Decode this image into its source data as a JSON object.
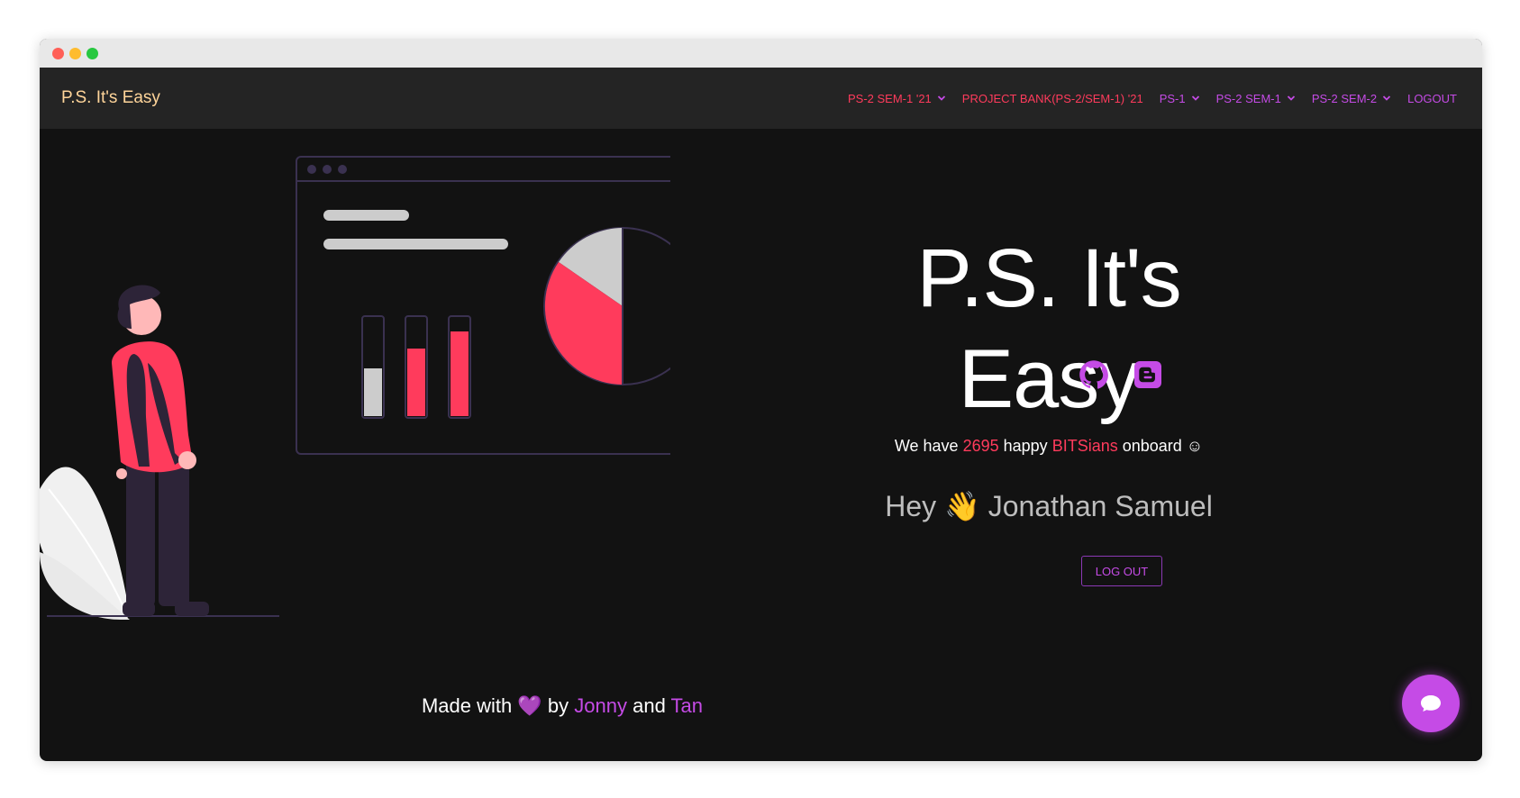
{
  "navbar": {
    "brand": "P.S. It's Easy",
    "items": [
      {
        "label": "PS-2 SEM-1 '21",
        "dropdown": true,
        "color": "#ff3b5c"
      },
      {
        "label": "PROJECT BANK(PS-2/SEM-1) '21",
        "dropdown": false,
        "color": "#ff3b5c"
      },
      {
        "label": "PS-1",
        "dropdown": true,
        "color": "#c54be6"
      },
      {
        "label": "PS-2 SEM-1",
        "dropdown": true,
        "color": "#c54be6"
      },
      {
        "label": "PS-2 SEM-2",
        "dropdown": true,
        "color": "#c54be6"
      },
      {
        "label": "LOGOUT",
        "dropdown": false,
        "color": "#c54be6"
      }
    ]
  },
  "hero": {
    "title": "P.S. It's Easy",
    "socials": [
      {
        "icon": "github-icon"
      },
      {
        "icon": "blogger-icon"
      }
    ],
    "stats": {
      "prefix": "We have",
      "count": "2695",
      "middle": "happy",
      "highlight": "BITSians",
      "suffix": "onboard ☺"
    },
    "greeting": {
      "hey": "Hey",
      "emoji": "👋",
      "name": "Jonathan Samuel"
    },
    "logout_button": "LOG OUT"
  },
  "footer": {
    "made_with": "Made with",
    "heart": "💜",
    "by": "by",
    "author1": "Jonny",
    "and": "and",
    "author2": "Tan"
  },
  "colors": {
    "accent_red": "#ff3b5c",
    "accent_purple": "#c54be6",
    "background": "#121212",
    "navbar": "#242424",
    "brand": "#ffd59a"
  },
  "chat": {
    "icon": "chat-bubble-icon"
  }
}
